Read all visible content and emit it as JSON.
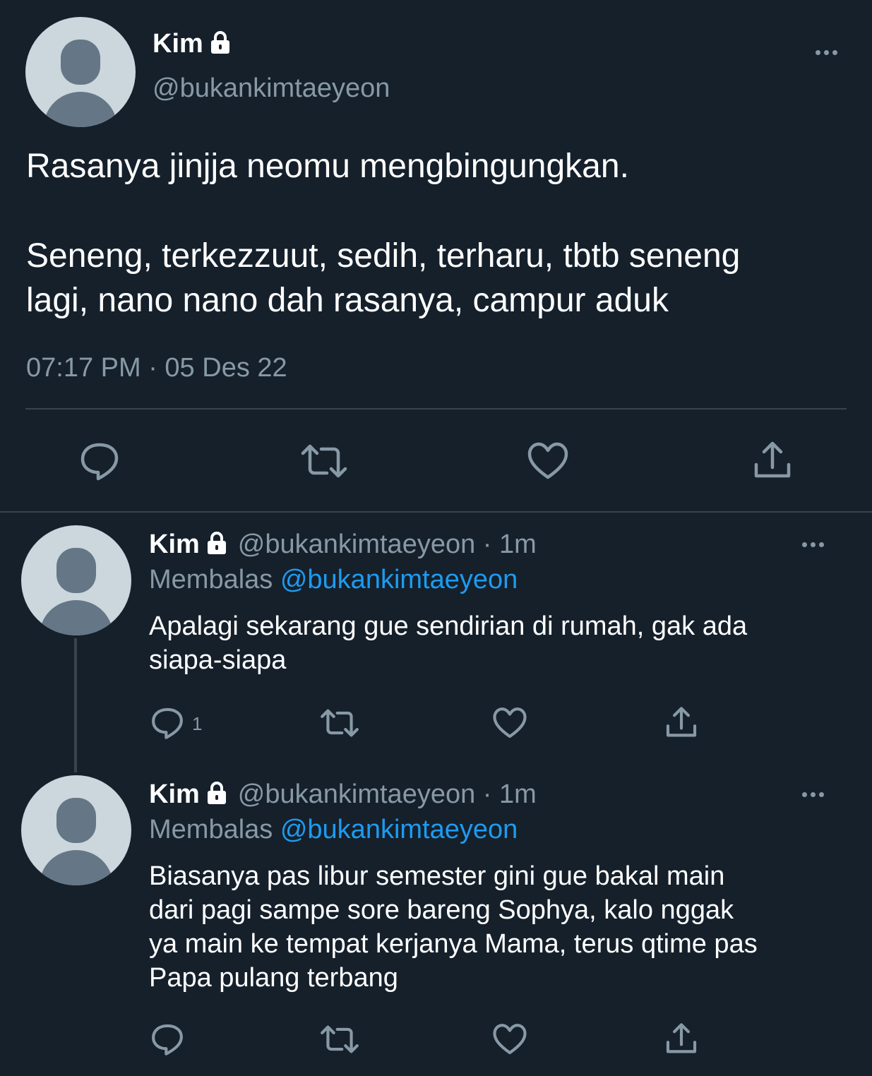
{
  "main_tweet": {
    "name": "Kim",
    "handle": "@bukankimtaeyeon",
    "text_line1": "Rasanya jinjja neomu mengbingungkan.",
    "text_line2": "Seneng, terkezzuut, sedih, terharu, tbtb seneng",
    "text_line3": "lagi, nano nano dah rasanya, campur aduk",
    "timestamp": "07:17 PM · 05 Des 22",
    "actions": [
      "reply-icon",
      "retweet-icon",
      "like-icon",
      "share-icon"
    ]
  },
  "replies": [
    {
      "name": "Kim",
      "handle": "@bukankimtaeyeon",
      "time": " · 1m",
      "replying_prefix": "Membalas ",
      "replying_to": "@bukankimtaeyeon",
      "text_line1": "Apalagi sekarang gue sendirian di rumah, gak ada",
      "text_line2": "siapa-siapa",
      "reply_count": "1"
    },
    {
      "name": "Kim",
      "handle": "@bukankimtaeyeon",
      "time": " · 1m",
      "replying_prefix": "Membalas ",
      "replying_to": "@bukankimtaeyeon",
      "text_line1": "Biasanya pas libur semester gini gue bakal main",
      "text_line2": "dari pagi sampe sore bareng Sophya, kalo nggak",
      "text_line3": "ya main ke tempat kerjanya Mama, terus qtime pas",
      "text_line4": "Papa pulang terbang",
      "reply_count": ""
    }
  ],
  "colors": {
    "background": "#15202b",
    "muted": "#8899a6",
    "link": "#1d9bf0",
    "divider": "#38444d"
  }
}
